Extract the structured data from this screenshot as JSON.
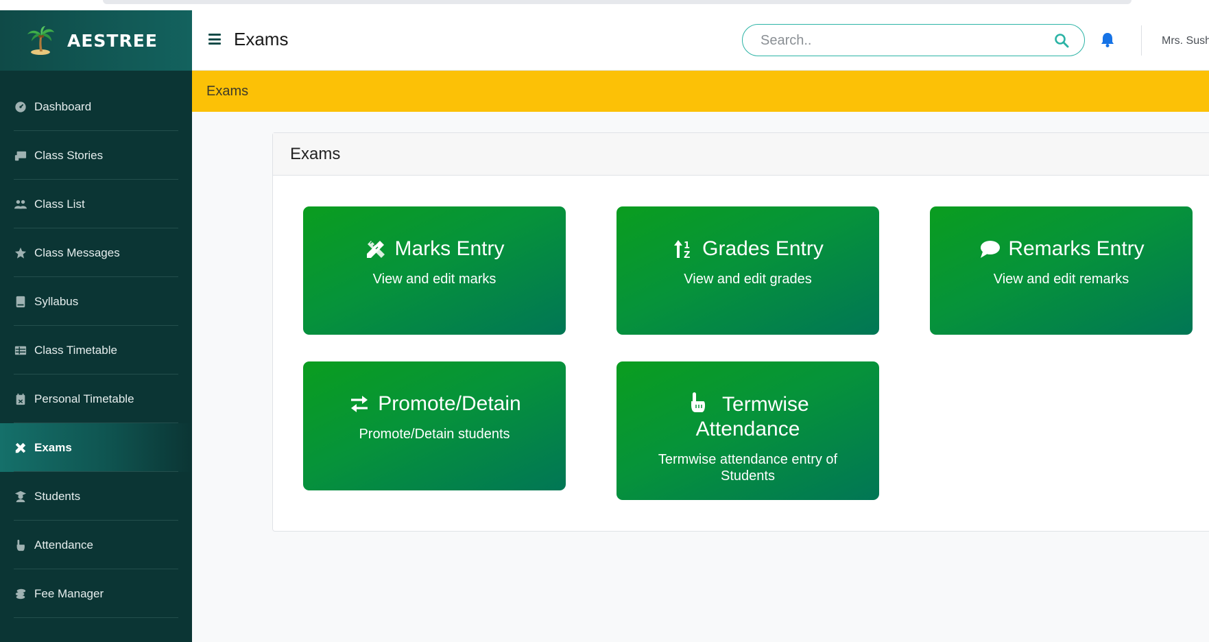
{
  "brand": {
    "name": "AESTREE"
  },
  "sidebar": {
    "items": [
      {
        "label": "Dashboard",
        "icon": "dashboard-icon"
      },
      {
        "label": "Class Stories",
        "icon": "class-stories-icon"
      },
      {
        "label": "Class List",
        "icon": "users-icon"
      },
      {
        "label": "Class Messages",
        "icon": "star-icon"
      },
      {
        "label": "Syllabus",
        "icon": "book-icon"
      },
      {
        "label": "Class Timetable",
        "icon": "table-icon"
      },
      {
        "label": "Personal Timetable",
        "icon": "calendar-icon"
      },
      {
        "label": "Exams",
        "icon": "exams-icon",
        "active": true
      },
      {
        "label": "Students",
        "icon": "student-icon"
      },
      {
        "label": "Attendance",
        "icon": "hand-icon"
      },
      {
        "label": "Fee Manager",
        "icon": "coins-icon"
      }
    ]
  },
  "header": {
    "title": "Exams",
    "search_placeholder": "Search..",
    "user_name": "Mrs. Sushma"
  },
  "breadcrumb": {
    "current": "Exams"
  },
  "panel": {
    "title": "Exams",
    "tiles": [
      {
        "title": "Marks Entry",
        "subtitle": "View and edit marks",
        "icon": "pencil-ruler-icon"
      },
      {
        "title": "Grades Entry",
        "subtitle": "View and edit grades",
        "icon": "sort-grade-icon"
      },
      {
        "title": "Remarks Entry",
        "subtitle": "View and edit remarks",
        "icon": "comment-icon"
      },
      {
        "title": "Promote/Detain",
        "subtitle": "Promote/Detain students",
        "icon": "swap-arrows-icon"
      },
      {
        "title": "Termwise Attendance",
        "subtitle": "Termwise attendance entry of Students",
        "icon": "raised-hand-icon"
      }
    ]
  },
  "colors": {
    "sidebar_bg": "#0b3534",
    "accent_yellow": "#fcc106",
    "tile_green": "#0a9d1f",
    "accent_teal": "#2bb3a5"
  }
}
